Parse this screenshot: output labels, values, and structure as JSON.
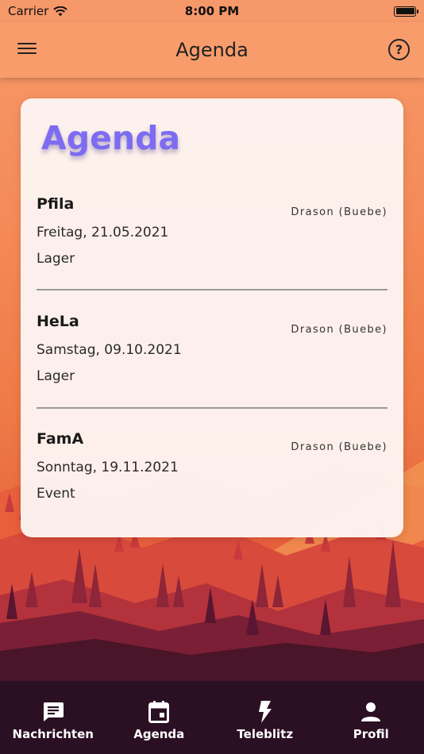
{
  "status_bar": {
    "carrier": "Carrier",
    "time": "8:00 PM",
    "wifi_icon": "wifi-icon",
    "battery_icon": "battery-icon"
  },
  "nav_bar": {
    "title": "Agenda",
    "menu_icon": "hamburger-menu-icon",
    "help_icon": "help-circle-icon",
    "help_glyph": "?"
  },
  "card": {
    "heading": "Agenda",
    "heading_color": "#7d6cf2",
    "events": [
      {
        "title": "Pfila",
        "group": "Drason (Buebe)",
        "date": "Freitag, 21.05.2021",
        "type": "Lager"
      },
      {
        "title": "HeLa",
        "group": "Drason (Buebe)",
        "date": "Samstag, 09.10.2021",
        "type": "Lager"
      },
      {
        "title": "FamA",
        "group": "Drason (Buebe)",
        "date": "Sonntag, 19.11.2021",
        "type": "Event"
      }
    ]
  },
  "tab_bar": {
    "background": "#2b0f22",
    "tabs": [
      {
        "label": "Nachrichten",
        "icon": "chat-bubble-icon"
      },
      {
        "label": "Agenda",
        "icon": "calendar-icon"
      },
      {
        "label": "Teleblitz",
        "icon": "lightning-bolt-icon"
      },
      {
        "label": "Profil",
        "icon": "person-icon"
      }
    ]
  }
}
